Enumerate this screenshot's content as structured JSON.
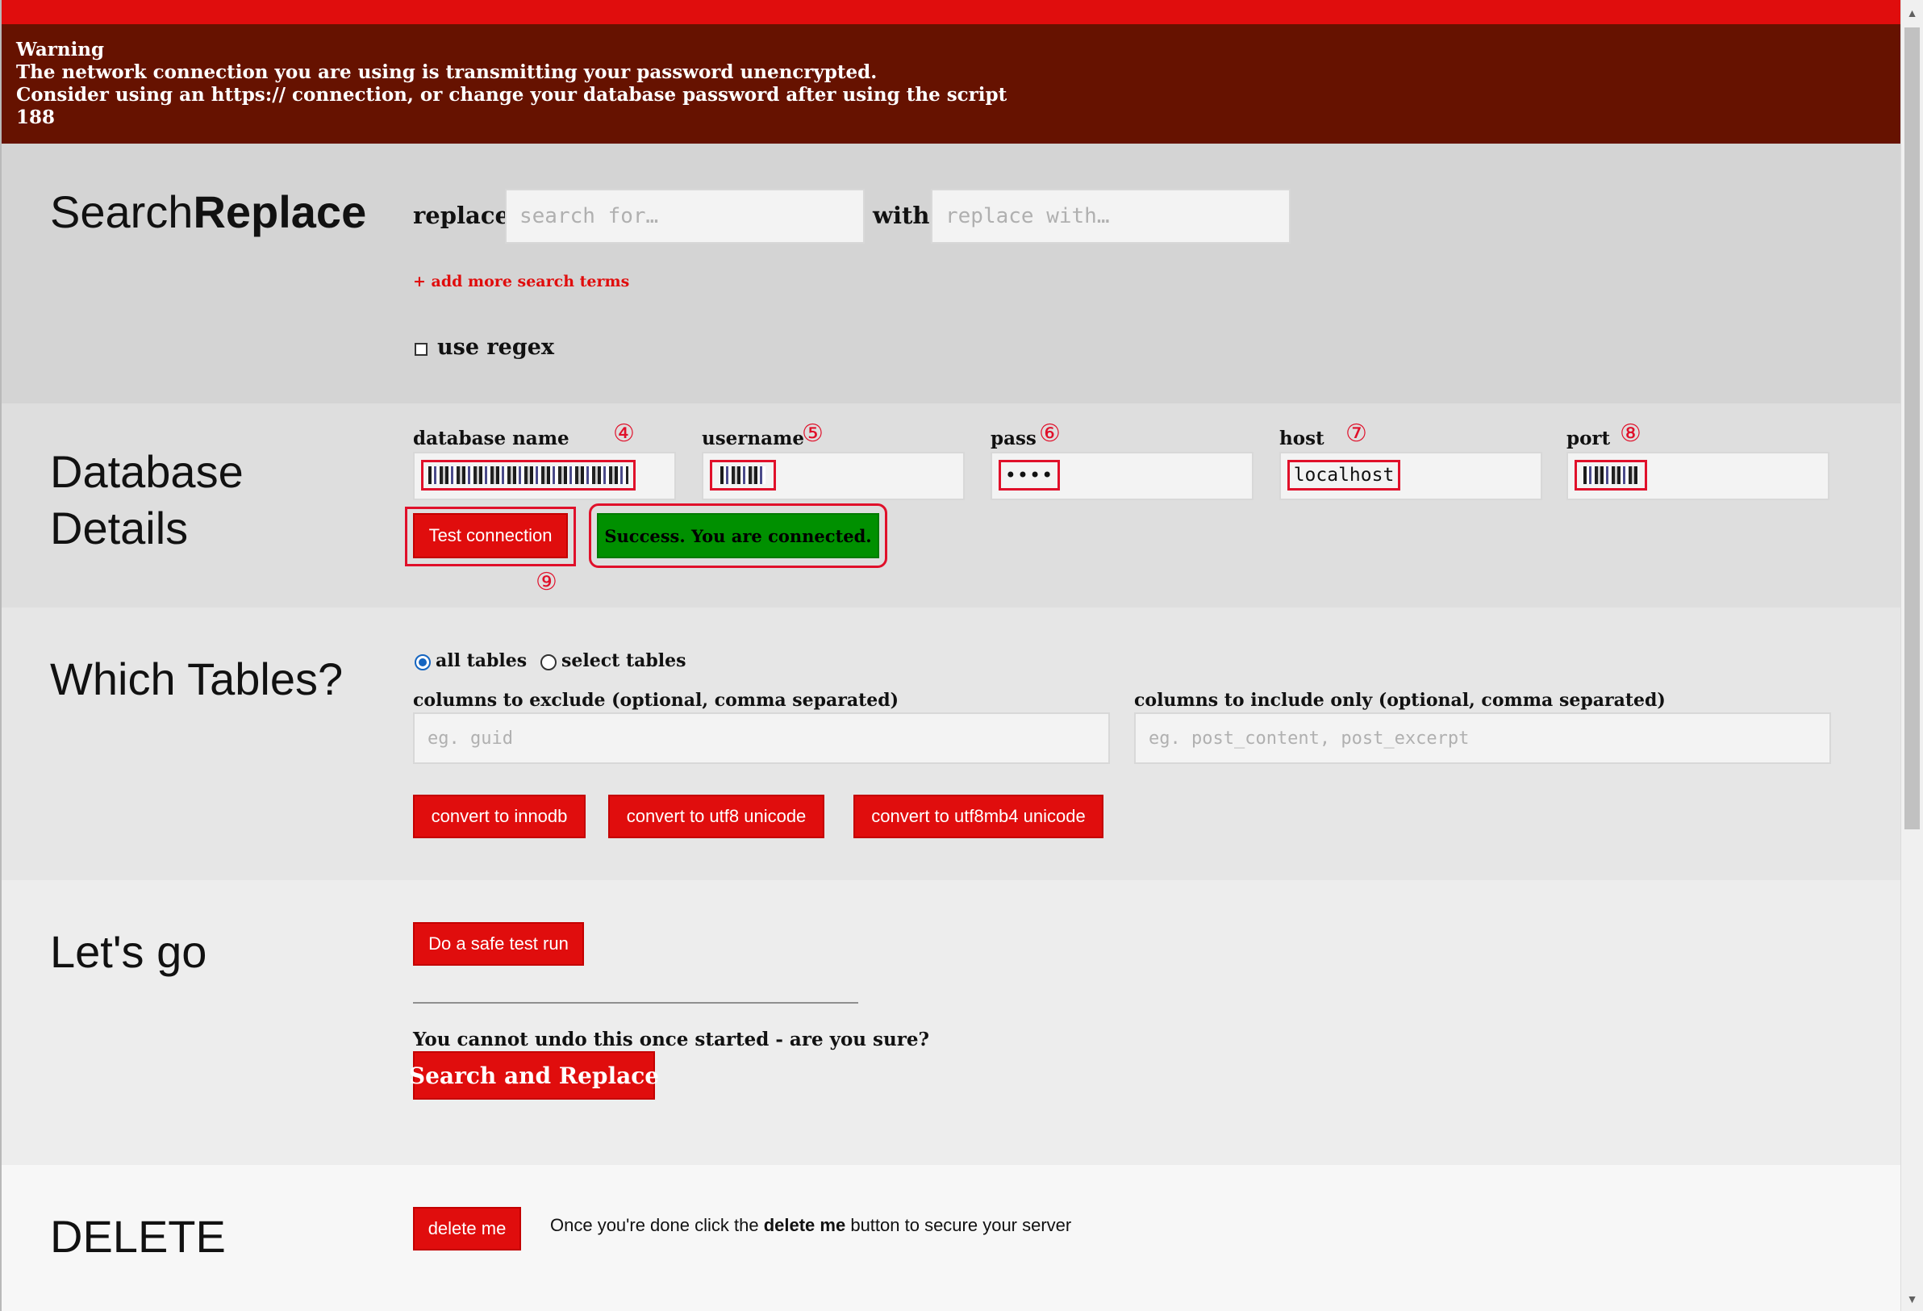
{
  "warning": {
    "line1": "Warning",
    "line2": "The network connection you are using is transmitting your password unencrypted.",
    "line3": "Consider using an https:// connection, or change your database password after using the script",
    "line4": "188"
  },
  "search_replace": {
    "title_light": "Search",
    "title_bold": "Replace",
    "replace_label": "replace",
    "search_placeholder": "search for…",
    "with_label": "with",
    "replace_placeholder": "replace with…",
    "add_more_link": "+ add more search terms",
    "regex_label": "use regex",
    "regex_checked": false
  },
  "database": {
    "title_line1": "Database",
    "title_line2": "Details",
    "fields": [
      {
        "label": "database name",
        "marker": "④"
      },
      {
        "label": "username",
        "marker": "⑤"
      },
      {
        "label": "pass",
        "marker": "⑥",
        "value": "••••"
      },
      {
        "label": "host",
        "marker": "⑦",
        "value": "localhost"
      },
      {
        "label": "port",
        "marker": "⑧"
      }
    ],
    "test_button": "Test connection",
    "test_marker": "⑨",
    "status_message": "Success. You are connected.",
    "status_color": "#009000"
  },
  "tables": {
    "title": "Which Tables?",
    "option_all": "all tables",
    "option_select": "select tables",
    "selected": "all tables",
    "exclude_label": "columns to exclude (optional, comma separated)",
    "exclude_placeholder": "eg. guid",
    "include_label": "columns to include only (optional, comma separated)",
    "include_placeholder": "eg. post_content, post_excerpt",
    "buttons": [
      "convert to innodb",
      "convert to utf8 unicode",
      "convert to utf8mb4 unicode"
    ]
  },
  "letsgo": {
    "title": "Let's go",
    "dry_run_button": "Do a safe test run",
    "confirm_text": "You cannot undo this once started - are you sure?",
    "run_button": "Search and Replace"
  },
  "delete": {
    "title": "DELETE",
    "button": "delete me",
    "note_before": "Once you're done click the",
    "note_bold": "delete me",
    "note_after": "button to secure your server"
  },
  "colors": {
    "accent_red": "#e00d0d",
    "warning_bg": "#661200",
    "success_green": "#009000",
    "annotation_red": "#e0102a"
  }
}
